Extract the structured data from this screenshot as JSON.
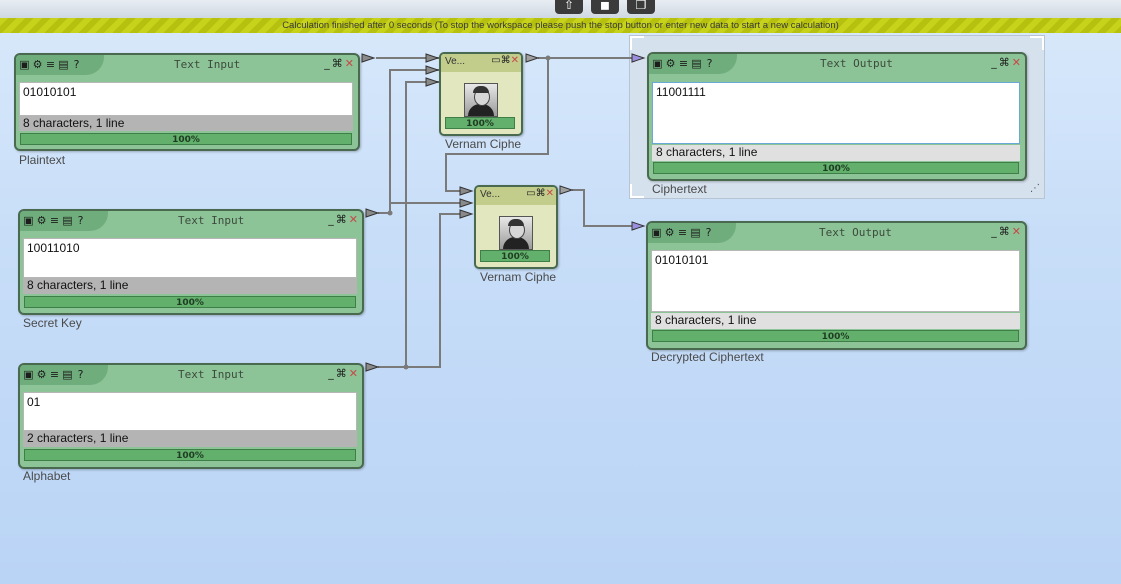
{
  "toolbar": {
    "up_icon": "⇧",
    "camera_icon": "◼",
    "chat_icon": "❐"
  },
  "status_message": "Calculation finished after 0 seconds (To stop the workspace please push the stop button or enter new data to start a new calculation)",
  "inputs": [
    {
      "title": "Text Input",
      "value": "01010101",
      "info": "8 characters,  1 line",
      "progress": "100%",
      "caption": "Plaintext"
    },
    {
      "title": "Text Input",
      "value": "10011010",
      "info": "8 characters,  1 line",
      "progress": "100%",
      "caption": "Secret Key"
    },
    {
      "title": "Text Input",
      "value": "01",
      "info": "2 characters,  1 line",
      "progress": "100%",
      "caption": "Alphabet"
    }
  ],
  "outputs": [
    {
      "title": "Text Output",
      "value": "11001111",
      "info": "8 characters,  1 line",
      "progress": "100%",
      "caption": "Ciphertext"
    },
    {
      "title": "Text Output",
      "value": "01010101",
      "info": "8 characters,  1 line",
      "progress": "100%",
      "caption": "Decrypted Ciphertext"
    }
  ],
  "vernam": [
    {
      "title": "Ve...",
      "progress": "100%",
      "caption": "Vernam Ciphe"
    },
    {
      "title": "Ve...",
      "progress": "100%",
      "caption": "Vernam Ciphe"
    }
  ],
  "icons": {
    "minimize": "_",
    "maximize": "⌘",
    "close": "✕"
  }
}
